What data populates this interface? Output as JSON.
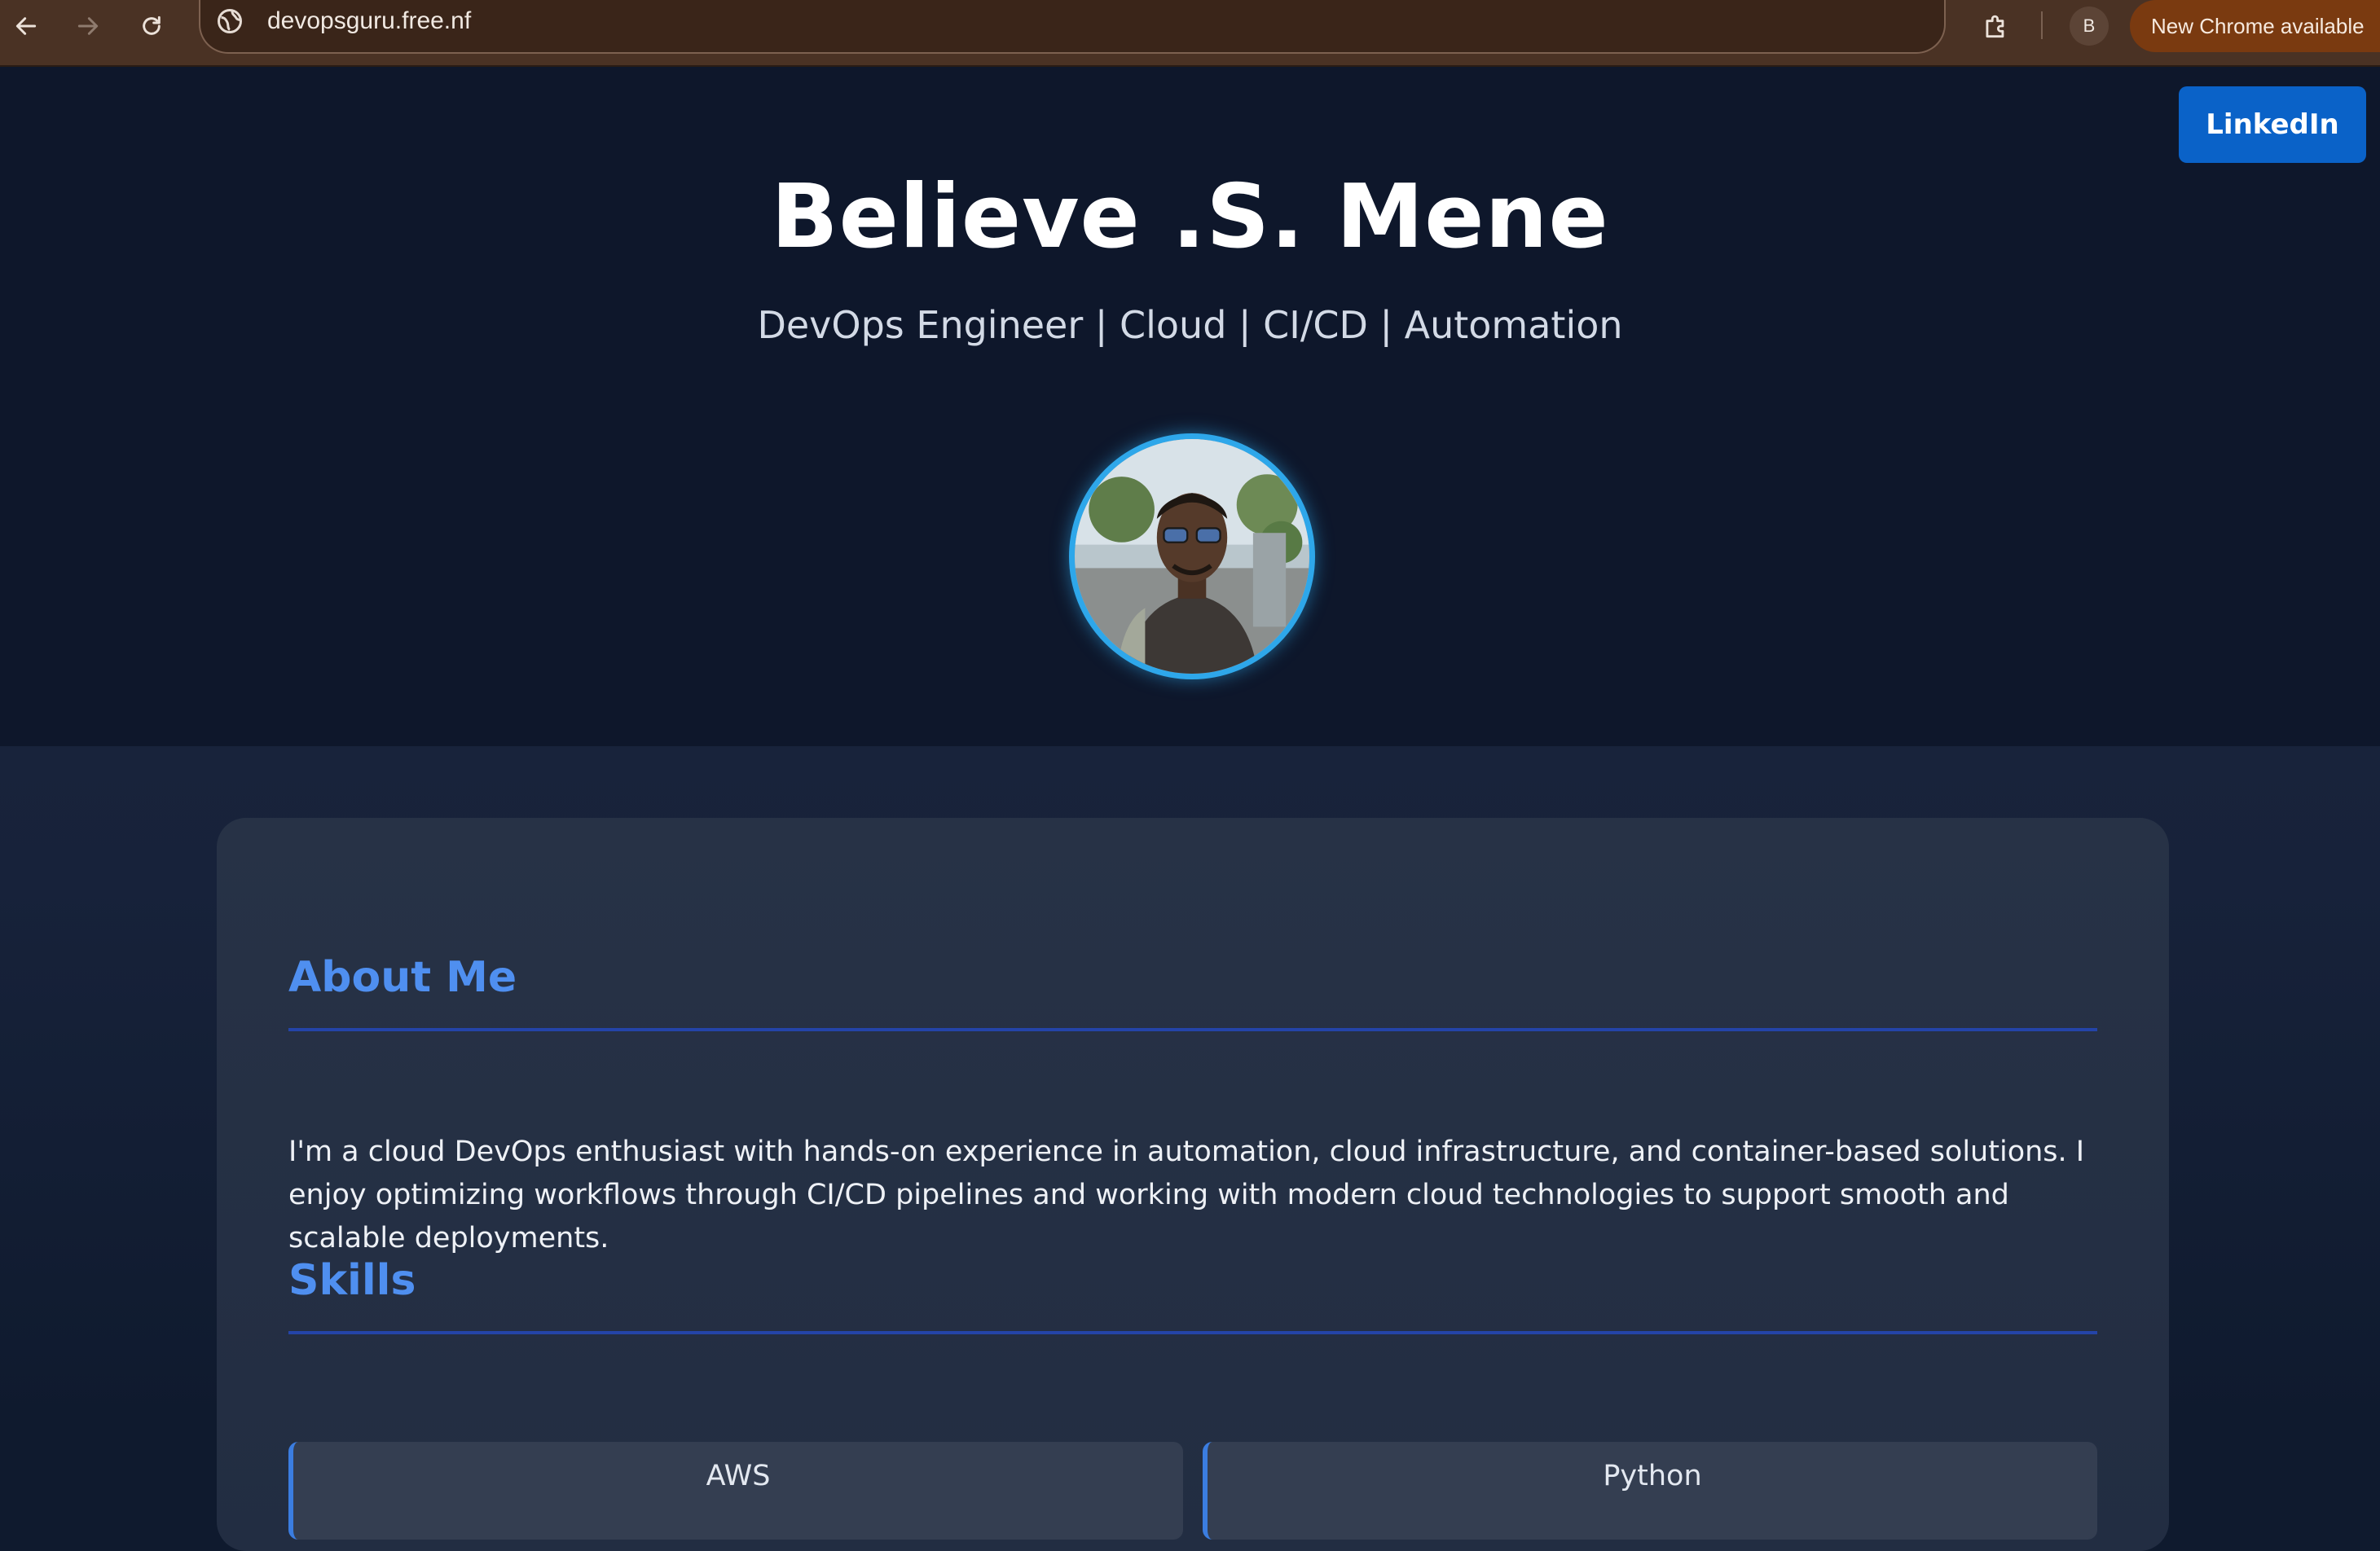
{
  "browser": {
    "url": "devopsguru.free.nf",
    "profile_initial": "B",
    "update_label": "New Chrome available",
    "icons": [
      "back-arrow-icon",
      "forward-arrow-icon",
      "reload-icon",
      "site-info-icon",
      "extensions-puzzle-icon"
    ]
  },
  "header": {
    "linkedin_label": "LinkedIn",
    "name": "Believe .S. Mene",
    "tagline": "DevOps Engineer | Cloud | CI/CD | Automation",
    "accent_color": "#2ea7ea"
  },
  "about": {
    "title": "About Me",
    "text": "I'm a cloud DevOps enthusiast with hands-on experience in automation, cloud infrastructure, and container-based solutions. I enjoy optimizing workflows through CI/CD pipelines and working with modern cloud technologies to support smooth and scalable deployments."
  },
  "skills": {
    "title": "Skills",
    "items": [
      "AWS",
      "Python"
    ]
  },
  "colors": {
    "hero_bg": "#0e172b",
    "section_title": "#4f8ff0",
    "linkedin_button": "#0a62c8"
  }
}
